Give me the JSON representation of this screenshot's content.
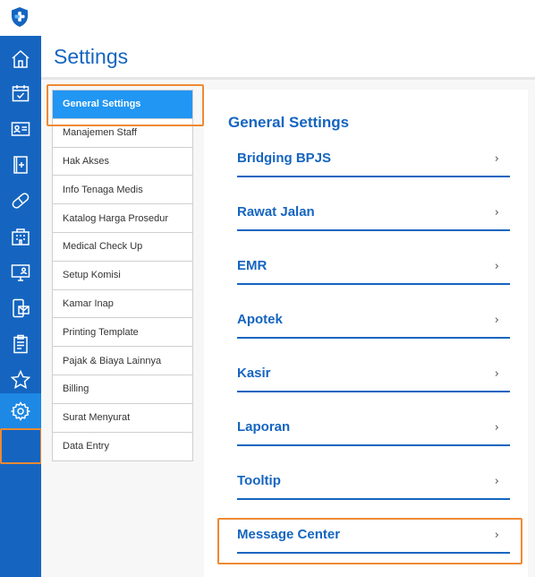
{
  "page": {
    "title": "Settings"
  },
  "submenu": {
    "items": [
      {
        "label": "General Settings",
        "active": true
      },
      {
        "label": "Manajemen Staff"
      },
      {
        "label": "Hak Akses"
      },
      {
        "label": "Info Tenaga Medis"
      },
      {
        "label": "Katalog Harga Prosedur"
      },
      {
        "label": "Medical Check Up"
      },
      {
        "label": "Setup Komisi"
      },
      {
        "label": "Kamar Inap"
      },
      {
        "label": "Printing Template"
      },
      {
        "label": "Pajak & Biaya Lainnya"
      },
      {
        "label": "Billing"
      },
      {
        "label": "Surat Menyurat"
      },
      {
        "label": "Data Entry"
      }
    ]
  },
  "panel": {
    "title": "General Settings",
    "chevron": "›",
    "items": [
      {
        "label": "Bridging BPJS"
      },
      {
        "label": "Rawat Jalan"
      },
      {
        "label": "EMR"
      },
      {
        "label": "Apotek"
      },
      {
        "label": "Kasir"
      },
      {
        "label": "Laporan"
      },
      {
        "label": "Tooltip"
      },
      {
        "label": "Message Center"
      }
    ]
  },
  "rail": {
    "icons": [
      "home-icon",
      "calendar-check-icon",
      "id-card-icon",
      "medical-book-icon",
      "pill-icon",
      "building-icon",
      "monitor-user-icon",
      "mobile-mail-icon",
      "clipboard-icon",
      "star-icon",
      "gear-icon"
    ],
    "active": "gear-icon"
  },
  "colors": {
    "rail": "#1565c0",
    "rail_active": "#1e88e5",
    "accent": "#1565c0",
    "submenu_active": "#2196f3",
    "highlight": "#ef8a33"
  }
}
